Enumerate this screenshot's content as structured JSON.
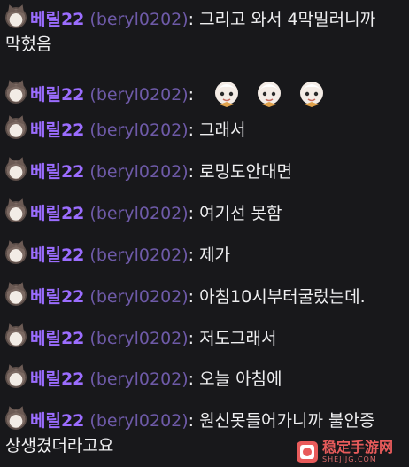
{
  "messages": [
    {
      "name": "베릴22",
      "login": "(beryl0202)",
      "colon": ":",
      "text": "그리고 와서 4막밀러니까 막혔음",
      "emotes": 0
    },
    {
      "name": "베릴22",
      "login": "(beryl0202)",
      "colon": ":",
      "text": "",
      "emotes": 3
    },
    {
      "name": "베릴22",
      "login": "(beryl0202)",
      "colon": ":",
      "text": "그래서",
      "emotes": 0
    },
    {
      "name": "베릴22",
      "login": "(beryl0202)",
      "colon": ":",
      "text": "로밍도안대면",
      "emotes": 0
    },
    {
      "name": "베릴22",
      "login": "(beryl0202)",
      "colon": ":",
      "text": "여기선 못함",
      "emotes": 0
    },
    {
      "name": "베릴22",
      "login": "(beryl0202)",
      "colon": ":",
      "text": "제가",
      "emotes": 0
    },
    {
      "name": "베릴22",
      "login": "(beryl0202)",
      "colon": ":",
      "text": "아침10시부터굴렀는데.",
      "emotes": 0
    },
    {
      "name": "베릴22",
      "login": "(beryl0202)",
      "colon": ":",
      "text": "저도그래서",
      "emotes": 0
    },
    {
      "name": "베릴22",
      "login": "(beryl0202)",
      "colon": ":",
      "text": "오늘 아침에",
      "emotes": 0
    },
    {
      "name": "베릴22",
      "login": "(beryl0202)",
      "colon": ":",
      "text": "원신못들어가니까 불안증 상생겼더라고요",
      "emotes": 0
    }
  ],
  "watermark": {
    "cn": "稳定手游网",
    "en": "SHEJIJG.COM"
  },
  "colors": {
    "name": "#9b6dff",
    "login": "#6e5aa8",
    "text": "#efeff1",
    "bg": "#18181b"
  }
}
